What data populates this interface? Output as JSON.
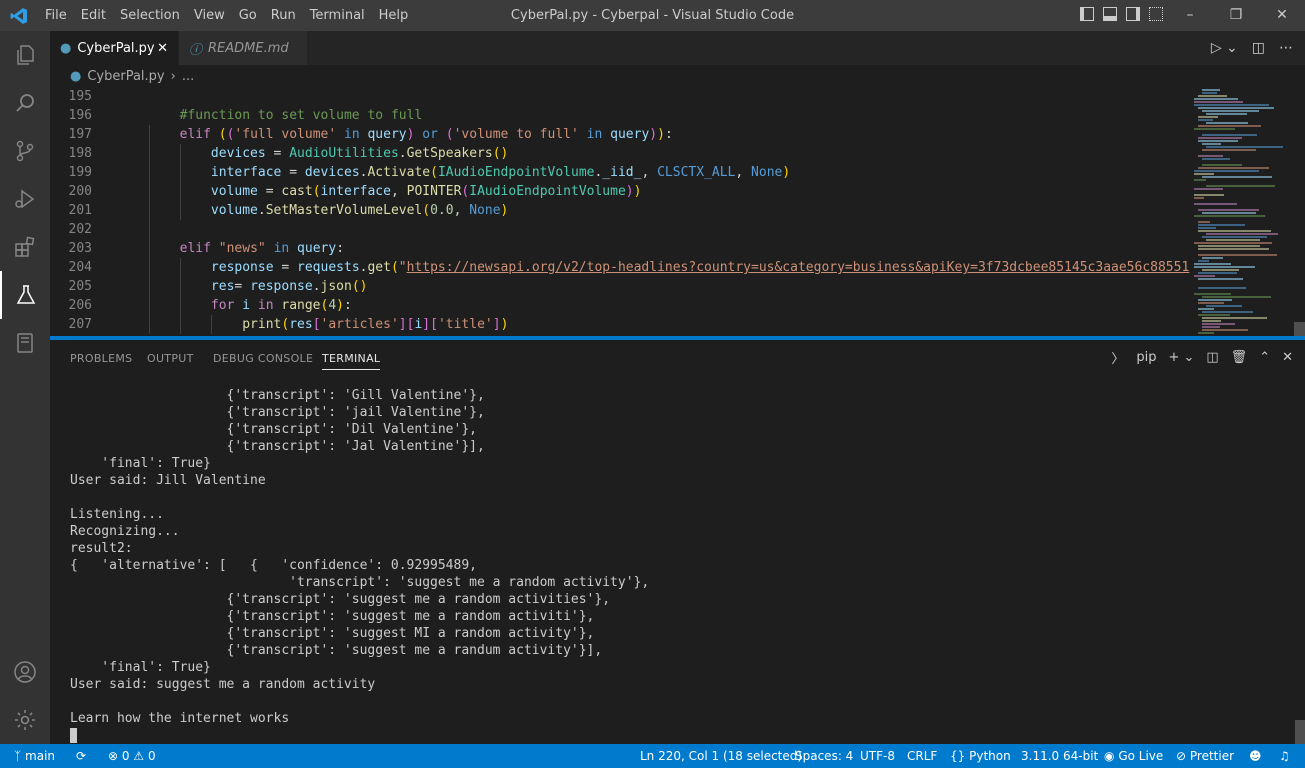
{
  "titlebar": {
    "menus": [
      "File",
      "Edit",
      "Selection",
      "View",
      "Go",
      "Run",
      "Terminal",
      "Help"
    ],
    "title": "CyberPal.py - Cyberpal - Visual Studio Code"
  },
  "tabs": [
    {
      "label": "CyberPal.py",
      "active": true
    },
    {
      "label": "README.md",
      "active": false
    }
  ],
  "breadcrumb": {
    "file": "CyberPal.py",
    "more": "..."
  },
  "code_lines": [
    {
      "n": "195",
      "indent": "",
      "html": ""
    },
    {
      "n": "196",
      "indent": "        ",
      "html": "<span class='c'>#function to set volume to full</span>"
    },
    {
      "n": "197",
      "indent": "        ",
      "html": "<span class='k'>elif</span> <span class='y'>(</span><span class='pp'>(</span><span class='s'>'full volume'</span> <span class='b'>in</span> <span class='v'>query</span><span class='pp'>)</span> <span class='b'>or</span> <span class='pp'>(</span><span class='s'>'volume to full'</span> <span class='b'>in</span> <span class='v'>query</span><span class='pp'>)</span><span class='y'>)</span><span class='p'>:</span>"
    },
    {
      "n": "198",
      "indent": "            ",
      "html": "<span class='v'>devices</span> <span class='p'>=</span> <span class='cl'>AudioUtilities</span><span class='p'>.</span><span class='f'>GetSpeakers</span><span class='y'>()</span>"
    },
    {
      "n": "199",
      "indent": "            ",
      "html": "<span class='v'>interface</span> <span class='p'>=</span> <span class='v'>devices</span><span class='p'>.</span><span class='f'>Activate</span><span class='y'>(</span><span class='cl'>IAudioEndpointVolume</span><span class='p'>.</span><span class='v'>_iid_</span><span class='p'>, </span><span class='b'>CLSCTX_ALL</span><span class='p'>, </span><span class='b'>None</span><span class='y'>)</span>"
    },
    {
      "n": "200",
      "indent": "            ",
      "html": "<span class='v'>volume</span> <span class='p'>=</span> <span class='f'>cast</span><span class='y'>(</span><span class='v'>interface</span><span class='p'>, </span><span class='f'>POINTER</span><span class='pp'>(</span><span class='cl'>IAudioEndpointVolume</span><span class='pp'>)</span><span class='y'>)</span>"
    },
    {
      "n": "201",
      "indent": "            ",
      "html": "<span class='v'>volume</span><span class='p'>.</span><span class='f'>SetMasterVolumeLevel</span><span class='y'>(</span><span class='n'>0.0</span><span class='p'>, </span><span class='b'>None</span><span class='y'>)</span>"
    },
    {
      "n": "202",
      "indent": "",
      "html": ""
    },
    {
      "n": "203",
      "indent": "        ",
      "html": "<span class='k'>elif</span> <span class='s'>\"news\"</span> <span class='b'>in</span> <span class='v'>query</span><span class='p'>:</span>"
    },
    {
      "n": "204",
      "indent": "            ",
      "html": "<span class='v'>response</span> <span class='p'>=</span> <span class='v'>requests</span><span class='p'>.</span><span class='f'>get</span><span class='y'>(</span><span class='s'>\"<u>https://newsapi.org/v2/top-headlines?country=us&amp;category=business&amp;apiKey=3f73dcbee85145c3aae56c88551</u></span>"
    },
    {
      "n": "205",
      "indent": "            ",
      "html": "<span class='v'>res</span><span class='p'>= </span><span class='v'>response</span><span class='p'>.</span><span class='f'>json</span><span class='y'>()</span>"
    },
    {
      "n": "206",
      "indent": "            ",
      "html": "<span class='k'>for</span> <span class='v'>i</span> <span class='k'>in</span> <span class='f'>range</span><span class='y'>(</span><span class='n'>4</span><span class='y'>)</span><span class='p'>:</span>"
    },
    {
      "n": "207",
      "indent": "                ",
      "html": "<span class='f'>print</span><span class='y'>(</span><span class='v'>res</span><span class='pp'>[</span><span class='s'>'articles'</span><span class='pp'>]</span><span class='pp'>[</span><span class='v'>i</span><span class='pp'>]</span><span class='pp'>[</span><span class='s'>'title'</span><span class='pp'>]</span><span class='y'>)</span>"
    }
  ],
  "panel": {
    "tabs": [
      "PROBLEMS",
      "OUTPUT",
      "DEBUG CONSOLE",
      "TERMINAL"
    ],
    "active_tab": "TERMINAL",
    "shell": "pip"
  },
  "terminal_lines": [
    "                    {'transcript': 'Gill Valentine'},",
    "                    {'transcript': 'jail Valentine'},",
    "                    {'transcript': 'Dil Valentine'},",
    "                    {'transcript': 'Jal Valentine'}],",
    "    'final': True}",
    "User said: Jill Valentine",
    "",
    "Listening...",
    "Recognizing...",
    "result2:",
    "{   'alternative': [   {   'confidence': 0.92995489,",
    "                            'transcript': 'suggest me a random activity'},",
    "                    {'transcript': 'suggest me a random activities'},",
    "                    {'transcript': 'suggest me a random activiti'},",
    "                    {'transcript': 'suggest MI a random activity'},",
    "                    {'transcript': 'suggest me a randum activity'}],",
    "    'final': True}",
    "User said: suggest me a random activity",
    "",
    "Learn how the internet works"
  ],
  "status": {
    "branch": "main",
    "errors": "0",
    "warnings": "0",
    "position": "Ln 220, Col 1 (18 selected)",
    "spaces": "Spaces: 4",
    "encoding": "UTF-8",
    "eol": "CRLF",
    "language": "Python",
    "interpreter": "3.11.0 64-bit",
    "golive": "Go Live",
    "prettier": "Prettier"
  },
  "colors": {
    "accent": "#007acc",
    "activity": "#333333",
    "editor": "#1e1e1e",
    "titlebar": "#3c3c3c"
  }
}
